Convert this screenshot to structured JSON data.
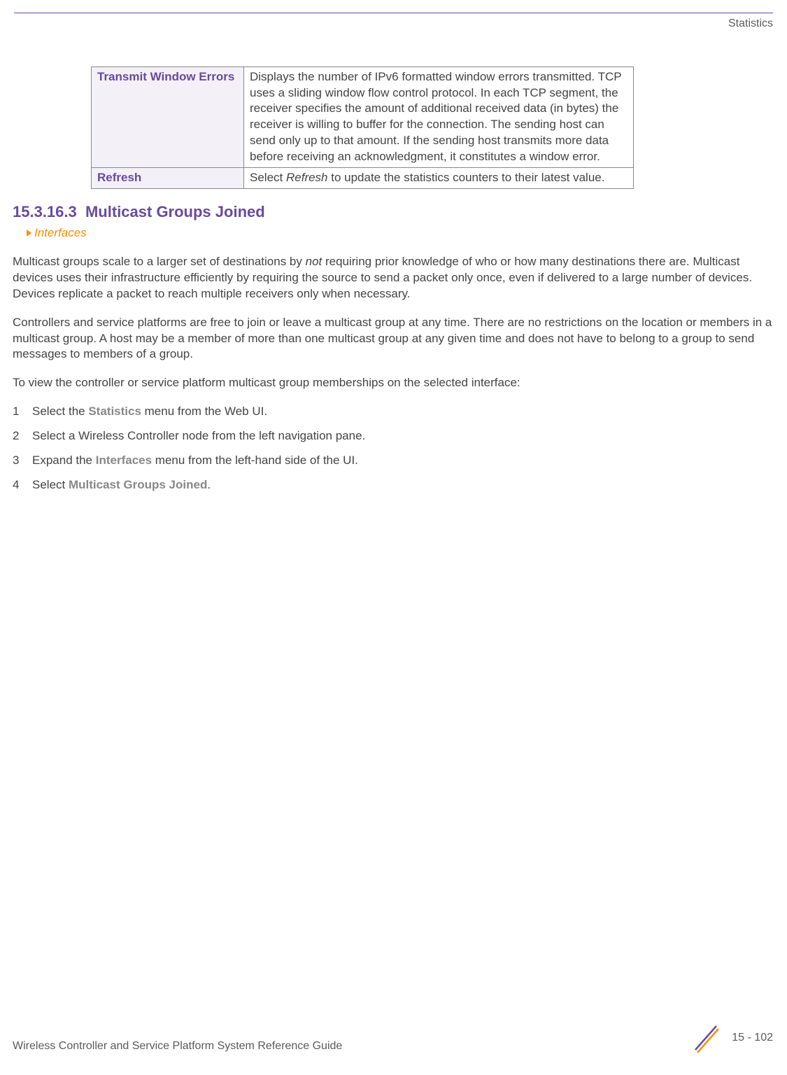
{
  "header": {
    "chapter": "Statistics"
  },
  "table": {
    "rows": [
      {
        "label": "Transmit Window Errors",
        "desc": "Displays the number of IPv6 formatted window errors transmitted. TCP uses a sliding window flow control protocol. In each TCP segment, the receiver specifies the amount of additional received data (in bytes) the receiver is willing to buffer for the connection. The sending host can send only up to that amount. If the sending host transmits more data before receiving an acknowledgment, it constitutes a window error."
      },
      {
        "label": "Refresh",
        "desc_pre": "Select ",
        "desc_italic": "Refresh",
        "desc_post": " to update the statistics counters to their latest value."
      }
    ]
  },
  "section": {
    "number": "15.3.16.3",
    "title": "Multicast Groups Joined",
    "breadcrumb": "Interfaces"
  },
  "para1": {
    "pre": "Multicast groups scale to a larger set of destinations by ",
    "italic": "not",
    "post": " requiring prior knowledge of who or how many destinations there are. Multicast devices uses their infrastructure efficiently by requiring the source to send a packet only once, even if delivered to a large number of devices. Devices replicate a packet to reach multiple receivers only when necessary."
  },
  "para2": "Controllers and service platforms are free to join or leave a multicast group at any time. There are no restrictions on the location or members in a multicast group. A host may be a member of more than one multicast group at any given time and does not have to belong to a group to send messages to members of a group.",
  "para3": "To view the controller or service platform multicast group memberships on the selected interface:",
  "steps": [
    {
      "pre": "Select the ",
      "bold": "Statistics",
      "post": " menu from the Web UI."
    },
    {
      "pre": "Select a Wireless Controller ",
      "post": "node from the left navigation pane."
    },
    {
      "pre": "Expand the ",
      "bold": "Interfaces",
      "post": " menu from the left-hand side of the UI."
    },
    {
      "pre": "Select ",
      "bold": "Multicast Groups Joined",
      "post": "."
    }
  ],
  "footer": {
    "title": "Wireless Controller and Service Platform System Reference Guide",
    "page": "15 - 102"
  }
}
